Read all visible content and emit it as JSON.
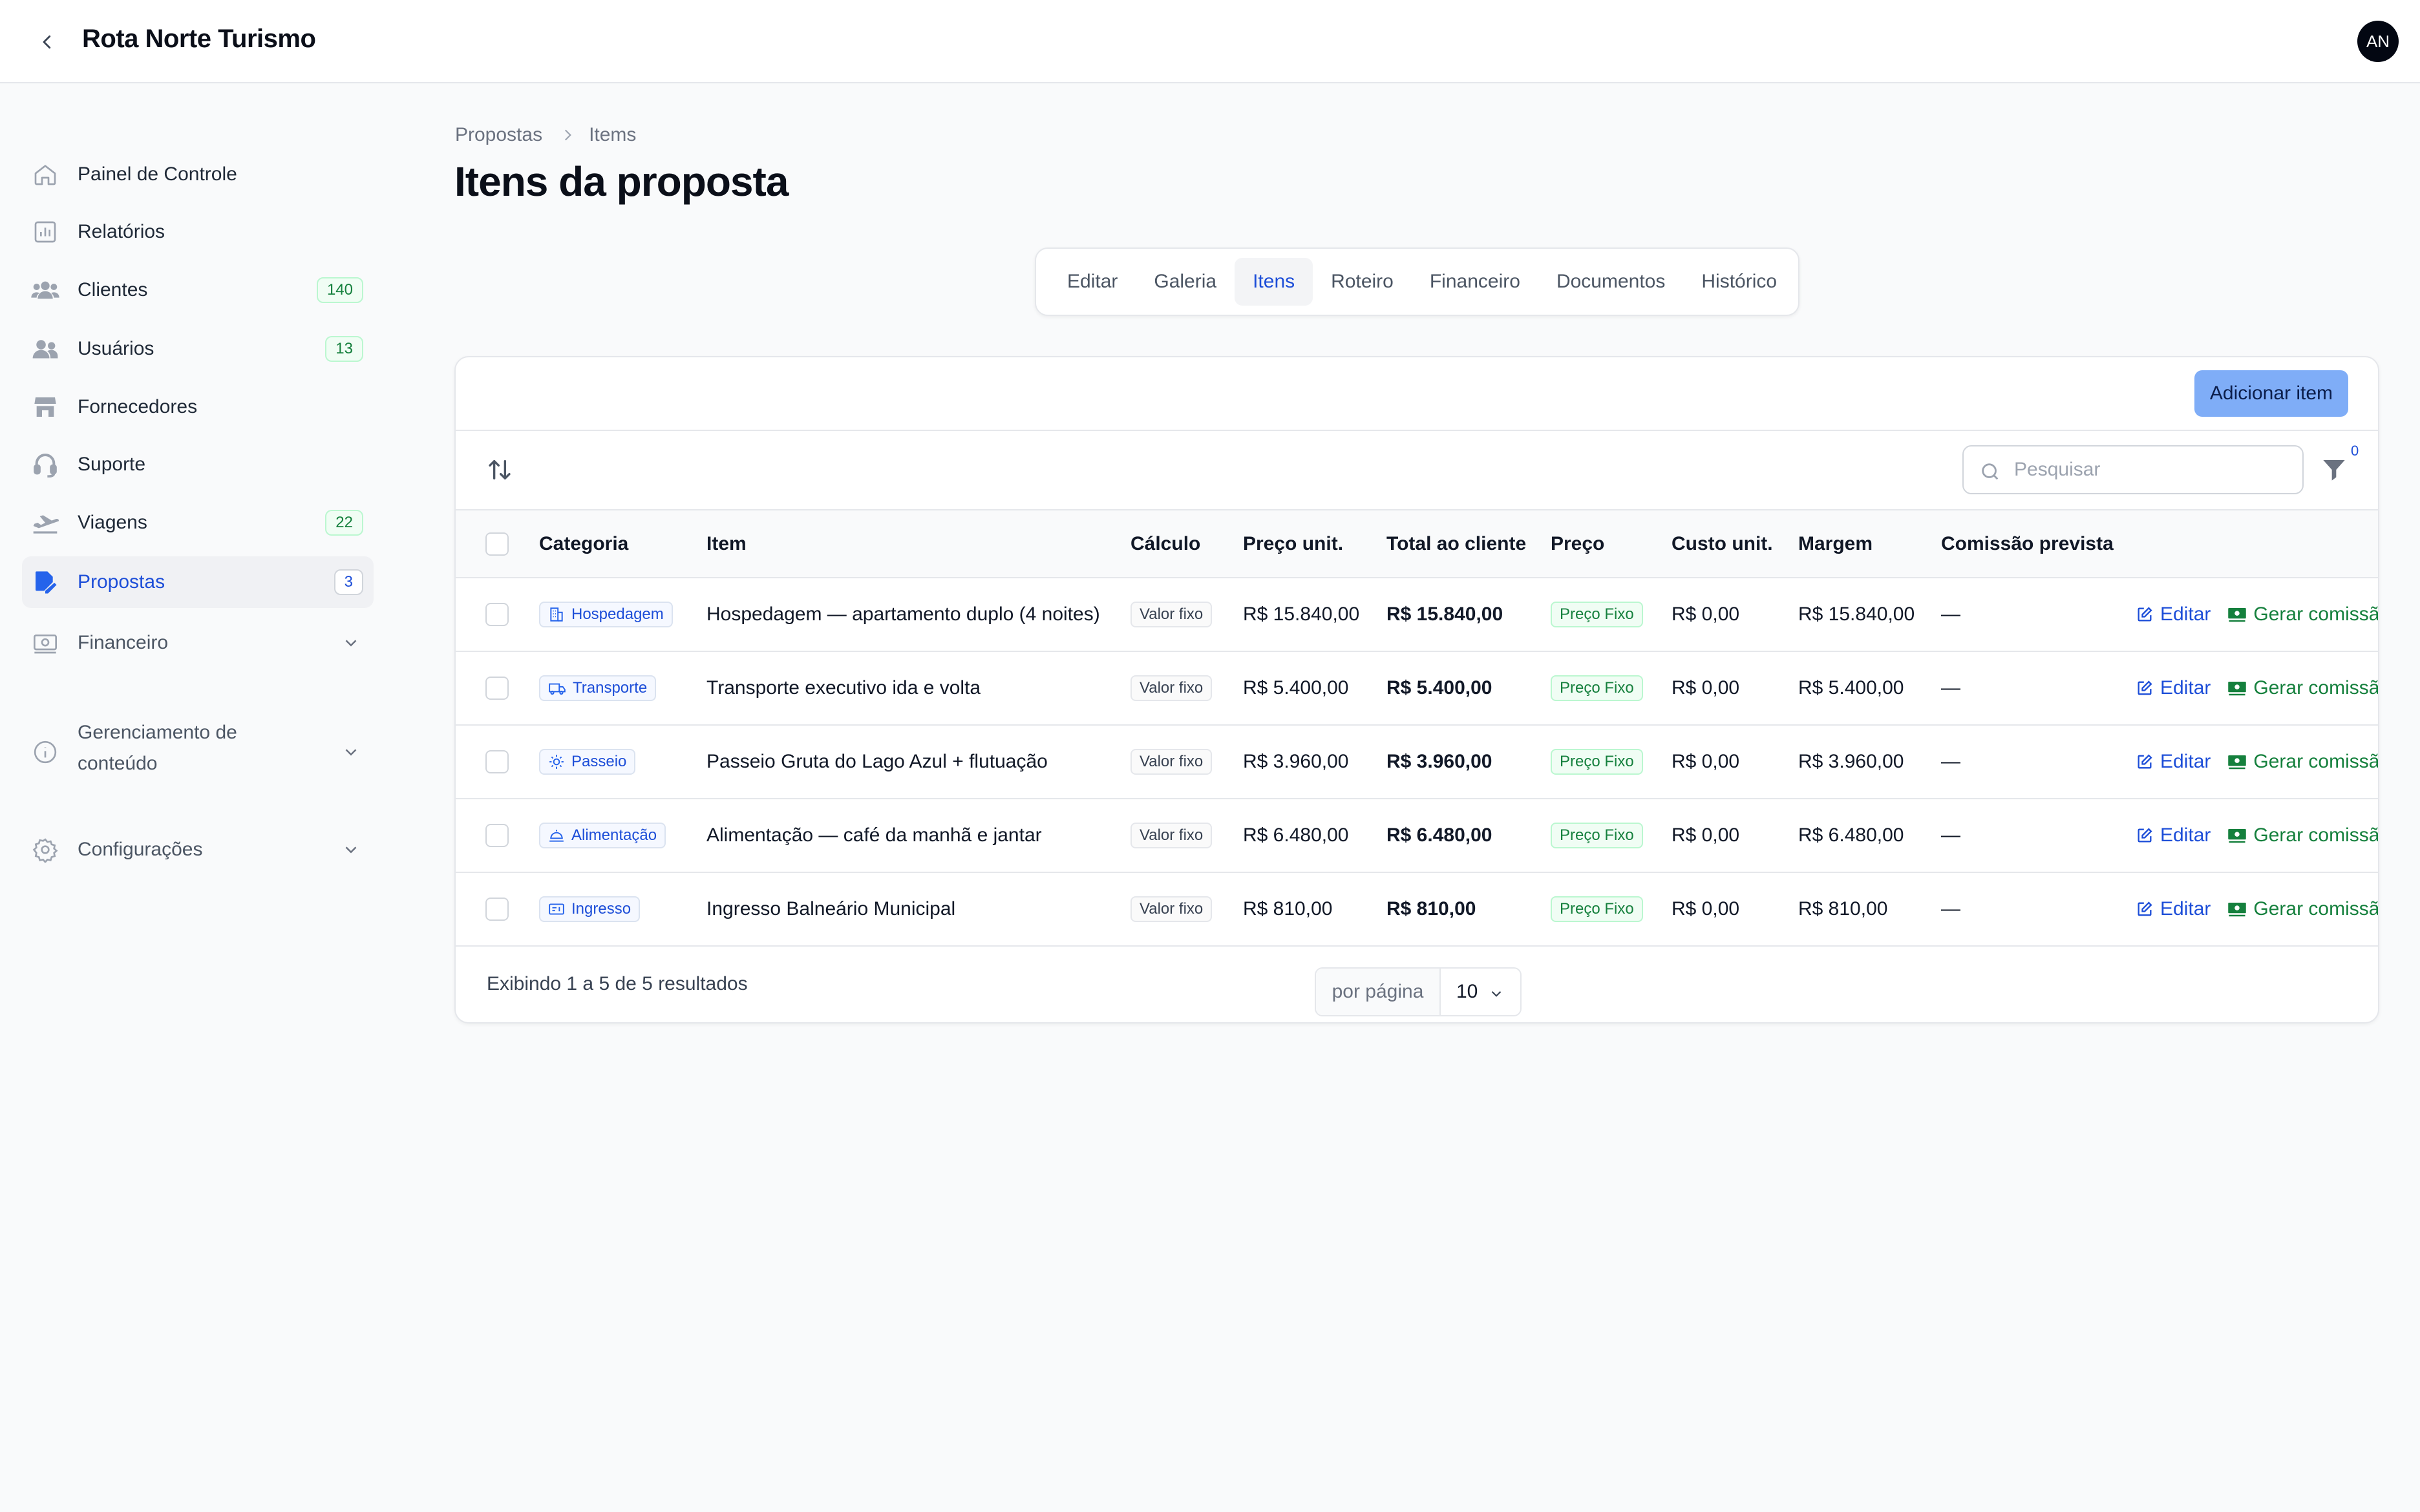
{
  "app": {
    "title": "Rota Norte Turismo",
    "avatar_initials": "AN"
  },
  "sidebar": {
    "items": [
      {
        "label": "Painel de Controle",
        "icon": "home-icon"
      },
      {
        "label": "Relatórios",
        "icon": "chart-icon"
      },
      {
        "label": "Clientes",
        "icon": "users-group-icon",
        "badge": "140"
      },
      {
        "label": "Usuários",
        "icon": "users-icon",
        "badge": "13"
      },
      {
        "label": "Fornecedores",
        "icon": "store-icon"
      },
      {
        "label": "Suporte",
        "icon": "headset-icon"
      },
      {
        "label": "Viagens",
        "icon": "plane-icon",
        "badge": "22"
      },
      {
        "label": "Propostas",
        "icon": "proposal-edit-icon",
        "badge": "3",
        "active": true
      }
    ],
    "groups": [
      {
        "label": "Financeiro",
        "icon": "money-icon"
      },
      {
        "label": "Gerenciamento de conteúdo",
        "icon": "info-icon"
      },
      {
        "label": "Configurações",
        "icon": "gear-icon"
      }
    ]
  },
  "breadcrumb": {
    "parent": "Propostas",
    "current": "Items"
  },
  "page": {
    "title": "Itens da proposta"
  },
  "tabs": [
    "Editar",
    "Galeria",
    "Itens",
    "Roteiro",
    "Financeiro",
    "Documentos",
    "Histórico"
  ],
  "active_tab": "Itens",
  "actions": {
    "add_item": "Adicionar item"
  },
  "search": {
    "placeholder": "Pesquisar",
    "value": ""
  },
  "filter": {
    "count": "0"
  },
  "table": {
    "columns": [
      "Categoria",
      "Item",
      "Cálculo",
      "Preço unit.",
      "Total ao cliente",
      "Preço",
      "Custo unit.",
      "Margem",
      "Comissão prevista"
    ],
    "rows": [
      {
        "category": "Hospedagem",
        "category_icon": "building-icon",
        "item": "Hospedagem — apartamento duplo (4 noites)",
        "calc": "Valor fixo",
        "unit_price": "R$ 15.840,00",
        "total": "R$ 15.840,00",
        "price_type": "Preço Fixo",
        "unit_cost": "R$ 0,00",
        "margin": "R$ 15.840,00",
        "commission": "—",
        "edit": "Editar",
        "generate": "Gerar comissão"
      },
      {
        "category": "Transporte",
        "category_icon": "truck-icon",
        "item": "Transporte executivo ida e volta",
        "calc": "Valor fixo",
        "unit_price": "R$ 5.400,00",
        "total": "R$ 5.400,00",
        "price_type": "Preço Fixo",
        "unit_cost": "R$ 0,00",
        "margin": "R$ 5.400,00",
        "commission": "—",
        "edit": "Editar",
        "generate": "Gerar comissão"
      },
      {
        "category": "Passeio",
        "category_icon": "sun-icon",
        "item": "Passeio Gruta do Lago Azul + flutuação",
        "calc": "Valor fixo",
        "unit_price": "R$ 3.960,00",
        "total": "R$ 3.960,00",
        "price_type": "Preço Fixo",
        "unit_cost": "R$ 0,00",
        "margin": "R$ 3.960,00",
        "commission": "—",
        "edit": "Editar",
        "generate": "Gerar comissão"
      },
      {
        "category": "Alimentação",
        "category_icon": "food-icon",
        "item": "Alimentação — café da manhã e jantar",
        "calc": "Valor fixo",
        "unit_price": "R$ 6.480,00",
        "total": "R$ 6.480,00",
        "price_type": "Preço Fixo",
        "unit_cost": "R$ 0,00",
        "margin": "R$ 6.480,00",
        "commission": "—",
        "edit": "Editar",
        "generate": "Gerar comissão"
      },
      {
        "category": "Ingresso",
        "category_icon": "ticket-icon",
        "item": "Ingresso Balneário Municipal",
        "calc": "Valor fixo",
        "unit_price": "R$ 810,00",
        "total": "R$ 810,00",
        "price_type": "Preço Fixo",
        "unit_cost": "R$ 0,00",
        "margin": "R$ 810,00",
        "commission": "—",
        "edit": "Editar",
        "generate": "Gerar comissão"
      }
    ]
  },
  "footer": {
    "results": "Exibindo 1 a 5 de 5 resultados",
    "per_page_label": "por página",
    "per_page_value": "10"
  },
  "colors": {
    "accent": "#1d4ed8",
    "button": "#7fadf7",
    "success": "#15803d",
    "background": "#f9fafb"
  }
}
